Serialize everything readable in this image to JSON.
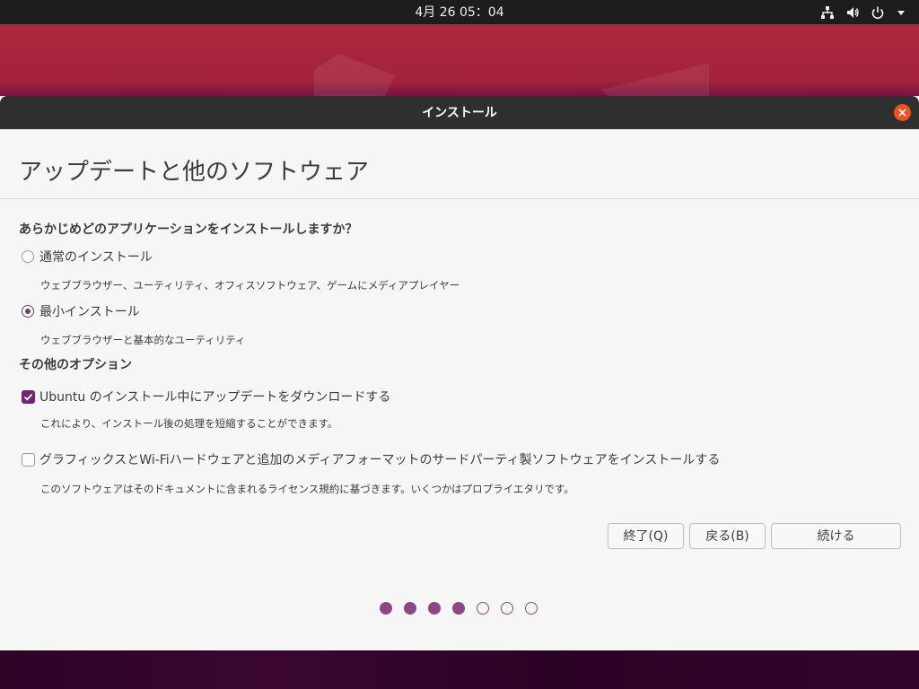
{
  "topbar": {
    "clock": "4月 26  05：04",
    "icons": [
      "network-icon",
      "volume-icon",
      "power-icon",
      "dropdown-arrow-icon"
    ]
  },
  "window": {
    "title": "インストール",
    "close_icon": "close-icon"
  },
  "page": {
    "title": "アップデートと他のソフトウェア",
    "question": "あらかじめどのアプリケーションをインストールしますか？",
    "install_options": [
      {
        "label": "通常のインストール",
        "description": "ウェブブラウザー、ユーティリティ、オフィスソフトウェア、ゲームにメディアプレイヤー",
        "selected": false
      },
      {
        "label": "最小インストール",
        "description": "ウェブブラウザーと基本的なユーティリティ",
        "selected": true
      }
    ],
    "other_options_heading": "その他のオプション",
    "other_options": [
      {
        "label": "Ubuntu のインストール中にアップデートをダウンロードする",
        "description": "これにより、インストール後の処理を短縮することができます。",
        "checked": true
      },
      {
        "label": "グラフィックスとWi-Fiハードウェアと追加のメディアフォーマットのサードパーティ製ソフトウェアをインストールする",
        "description": "このソフトウェアはそのドキュメントに含まれるライセンス規約に基づきます。いくつかはプロプライエタリです。",
        "checked": false
      }
    ]
  },
  "buttons": {
    "quit": "終了(Q)",
    "back": "戻る(B)",
    "continue": "続ける"
  },
  "progress": {
    "total_steps": 7,
    "completed_steps": 4
  },
  "colors": {
    "accent": "#77216f",
    "dot": "#8d4785",
    "close": "#e9541f",
    "titlebar": "#2f2f2f"
  }
}
